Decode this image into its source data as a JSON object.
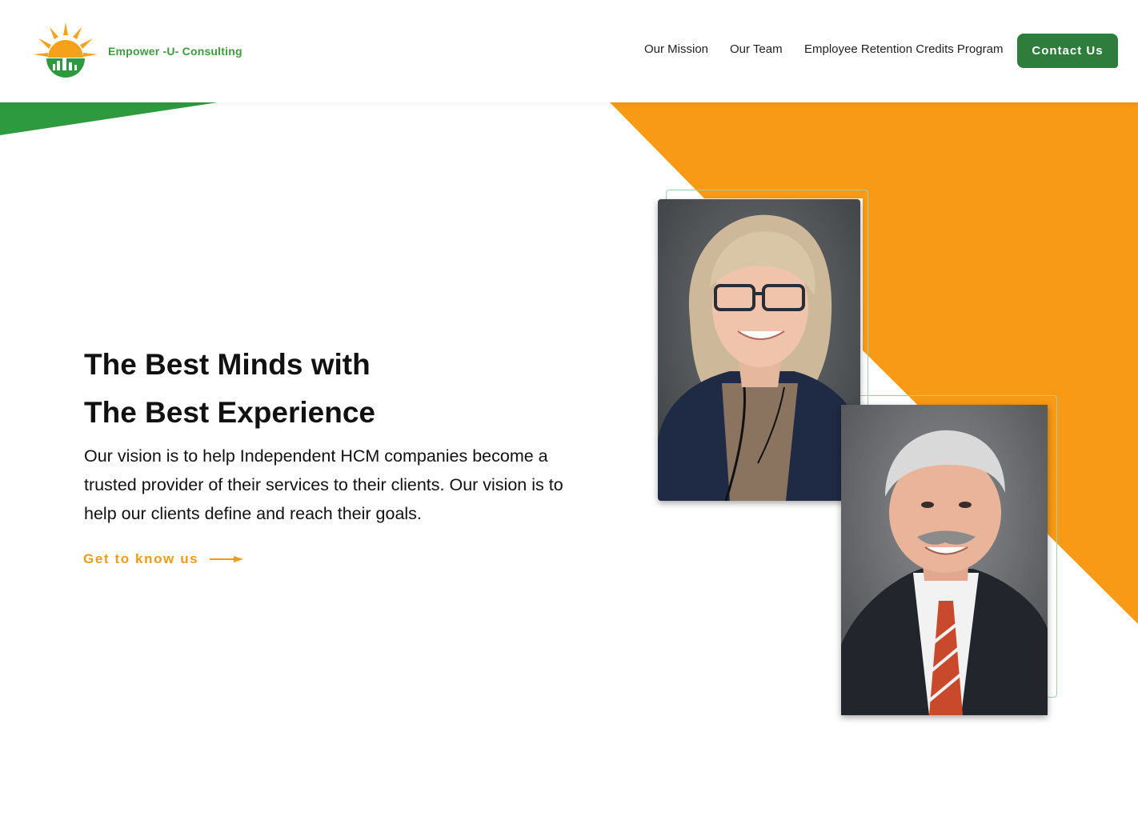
{
  "header": {
    "brand_name": "Empower -U- Consulting",
    "nav": [
      {
        "label": "Our Mission"
      },
      {
        "label": "Our Team"
      },
      {
        "label": "Employee Retention Credits Program"
      }
    ],
    "contact_label": "Contact Us"
  },
  "hero": {
    "title_line1": "The Best Minds with",
    "title_line2": "The Best Experience",
    "description": "Our vision is to help Independent HCM companies become a trusted provider of their services to their clients. Our vision is to help our clients define and reach their goals.",
    "cta_label": "Get to know us"
  },
  "colors": {
    "brand_green": "#2f7d3d",
    "accent_orange": "#f89a15",
    "wedge_green": "#2e9a3f"
  },
  "icons": {
    "logo": "sun-city-logo",
    "cta_arrow": "arrow-right-icon"
  }
}
